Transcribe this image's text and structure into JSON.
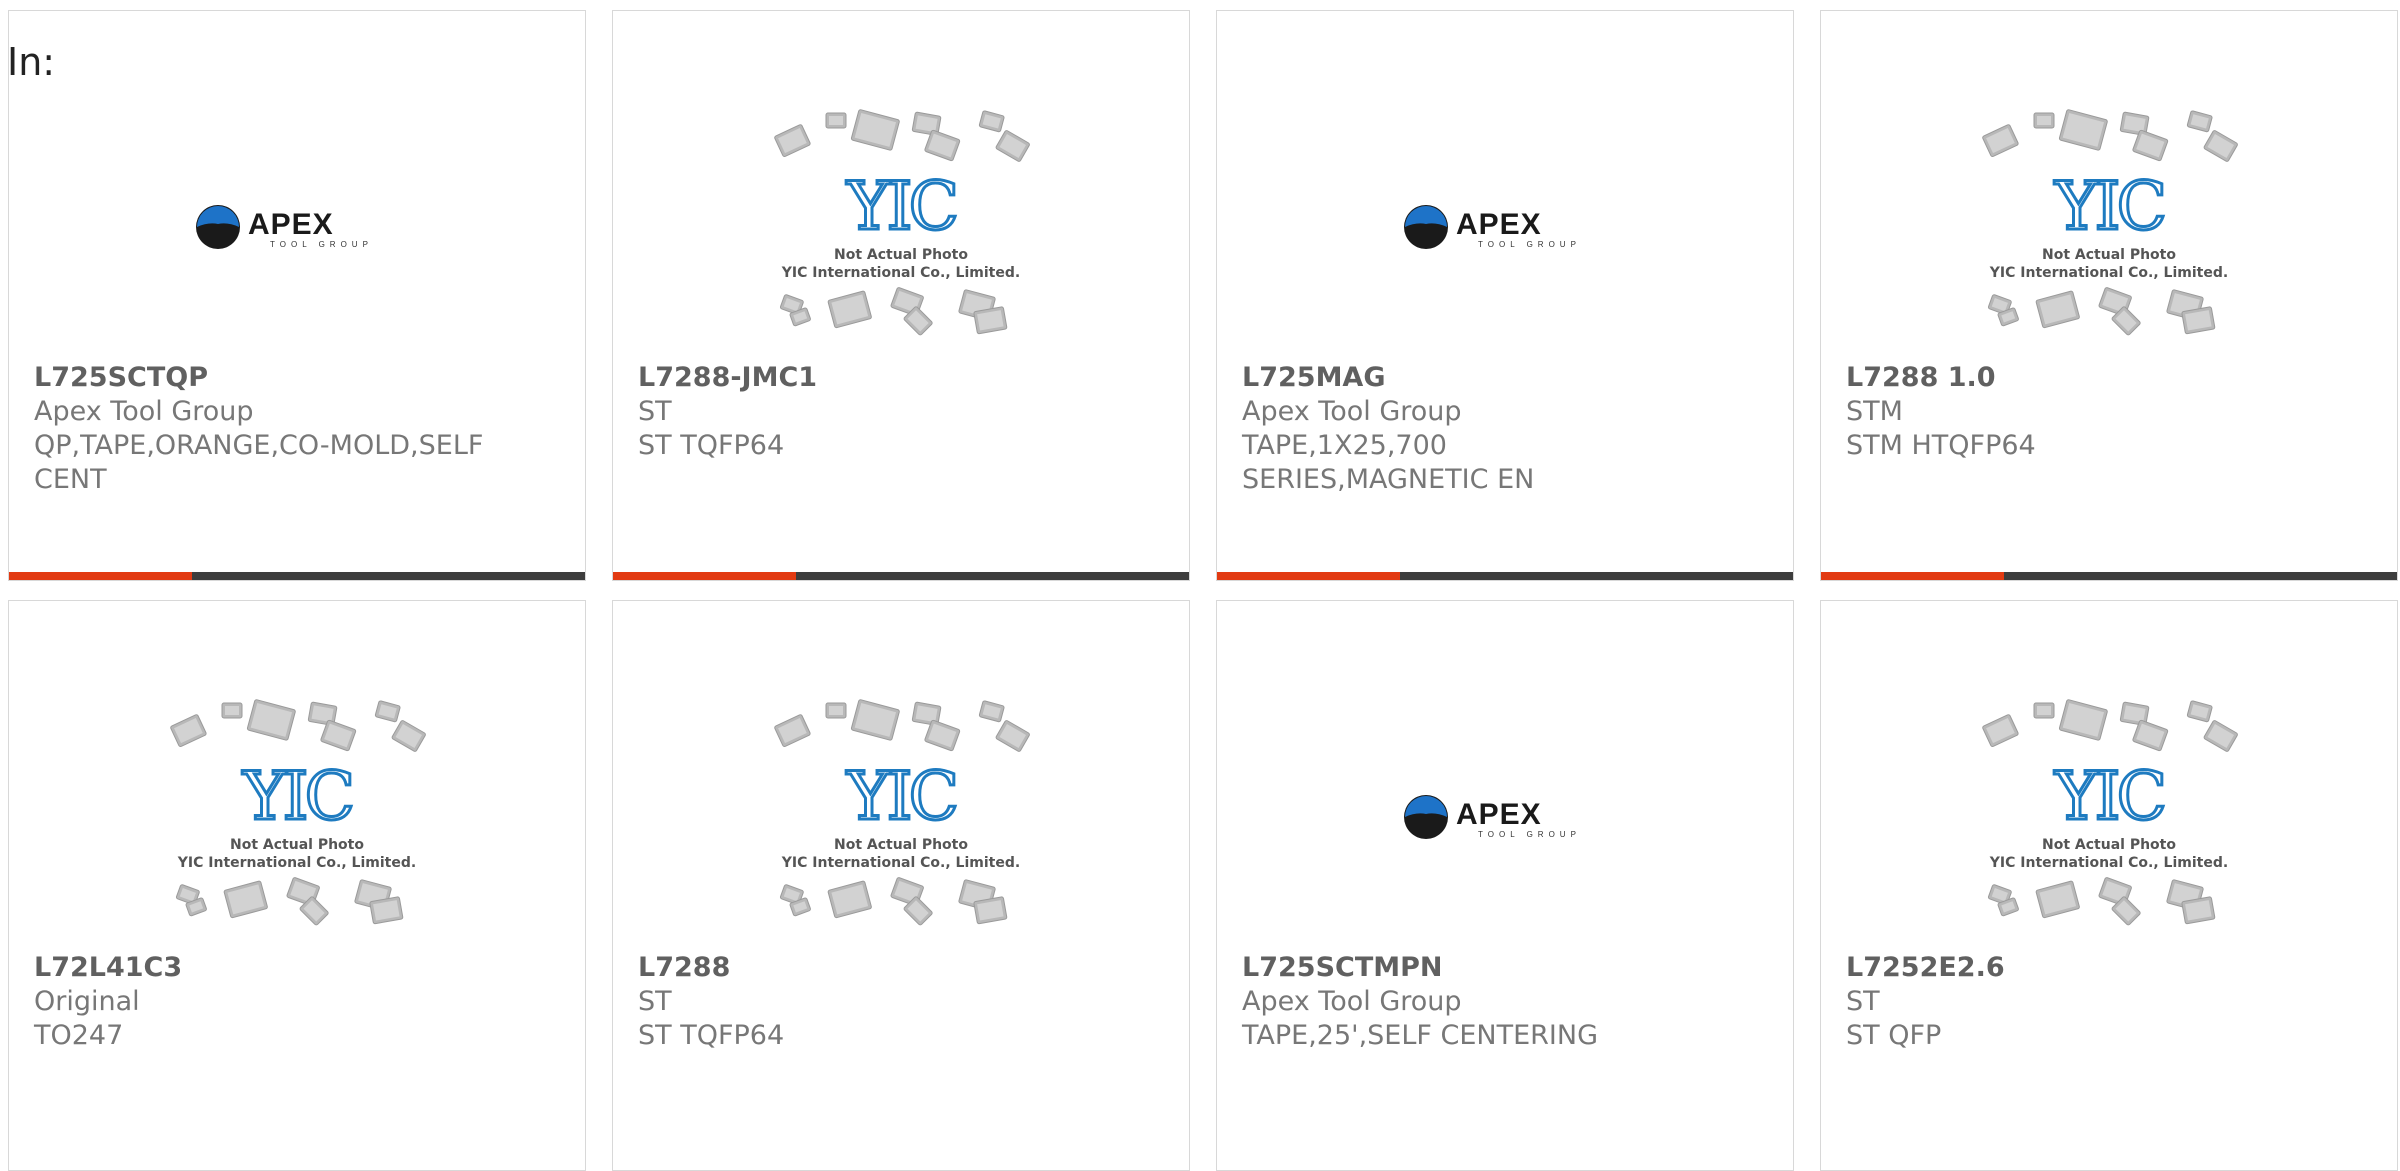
{
  "page": {
    "in_label": "In:"
  },
  "brands": {
    "apex": {
      "name": "APEX",
      "sub": "TOOL GROUP"
    },
    "yic": {
      "logo_text": "YIC",
      "line1": "Not Actual Photo",
      "line2": "YIC International Co., Limited."
    }
  },
  "colors": {
    "bar_accent": "#e23a12",
    "bar_dark": "#3d3d3d",
    "yic_blue": "#1e7bc0"
  },
  "products": [
    {
      "part_number": "L725SCTQP",
      "manufacturer": "Apex Tool Group",
      "description": "QP,TAPE,ORANGE,CO-MOLD,SELF\nCENT",
      "image": "apex-logo",
      "has_bar": true
    },
    {
      "part_number": "L7288-JMC1",
      "manufacturer": "ST",
      "description": "ST TQFP64",
      "image": "yic-placeholder",
      "has_bar": true
    },
    {
      "part_number": "L725MAG",
      "manufacturer": "Apex Tool Group",
      "description": "TAPE,1X25,700\nSERIES,MAGNETIC EN",
      "image": "apex-logo",
      "has_bar": true
    },
    {
      "part_number": "L7288 1.0",
      "manufacturer": "STM",
      "description": "STM HTQFP64",
      "image": "yic-placeholder",
      "has_bar": true
    },
    {
      "part_number": "L72L41C3",
      "manufacturer": "Original",
      "description": "TO247",
      "image": "yic-placeholder",
      "has_bar": false
    },
    {
      "part_number": "L7288",
      "manufacturer": "ST",
      "description": "ST TQFP64",
      "image": "yic-placeholder",
      "has_bar": false
    },
    {
      "part_number": "L725SCTMPN",
      "manufacturer": "Apex Tool Group",
      "description": "TAPE,25',SELF CENTERING",
      "image": "apex-logo",
      "has_bar": false
    },
    {
      "part_number": "L7252E2.6",
      "manufacturer": "ST",
      "description": "ST QFP",
      "image": "yic-placeholder",
      "has_bar": false
    }
  ]
}
